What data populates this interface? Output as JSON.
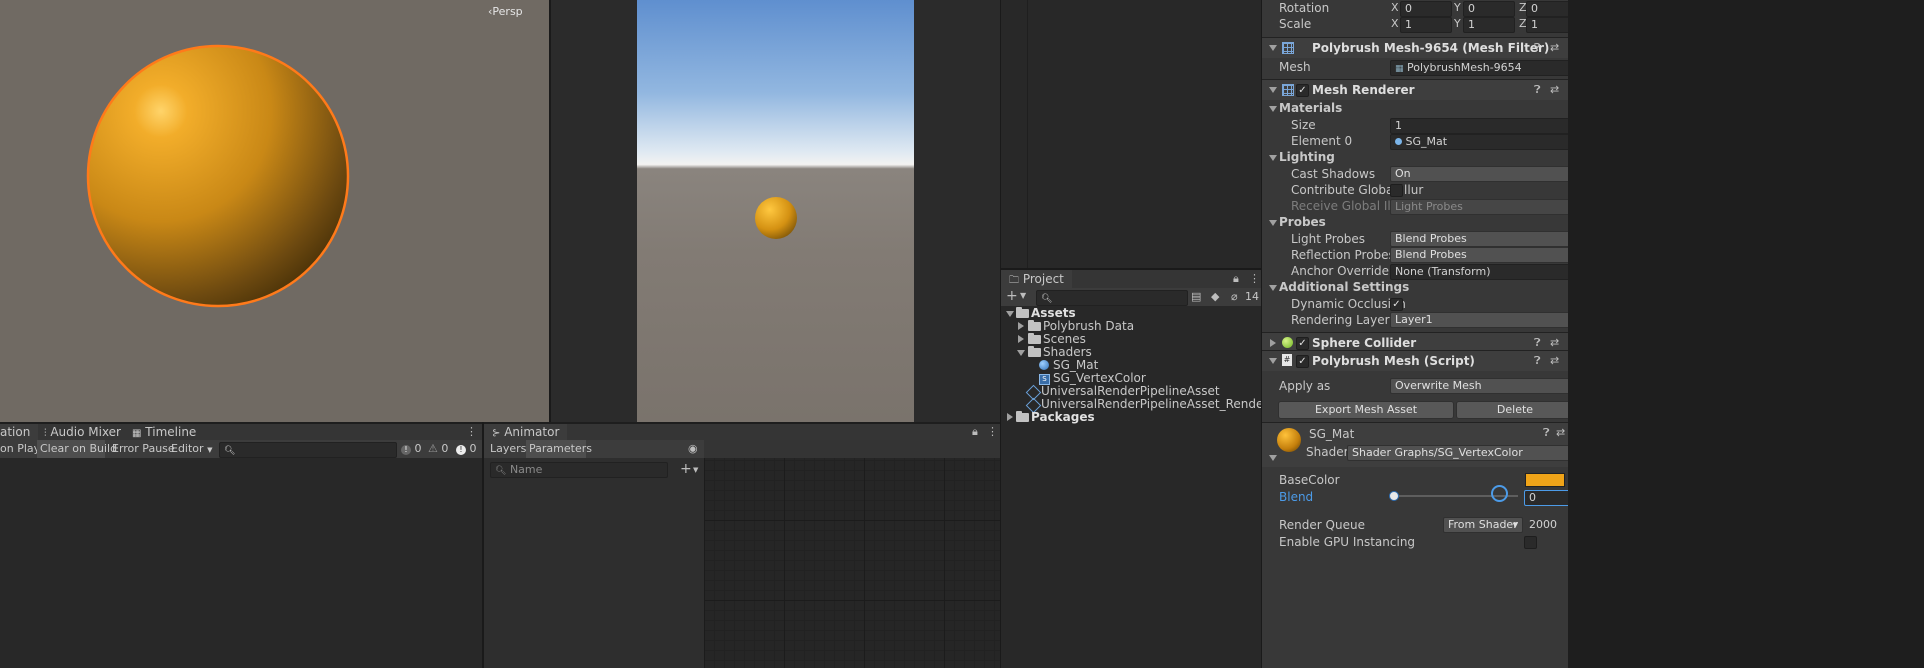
{
  "scene_view": {
    "persp_label": "Persp"
  },
  "console": {
    "tabs": [
      "ation",
      "Audio Mixer",
      "Timeline"
    ],
    "toolbar": [
      "on Play",
      "Clear on Build",
      "Error Pause",
      "Editor"
    ],
    "counts": [
      "0",
      "0",
      "0"
    ]
  },
  "animator": {
    "tab": "Animator",
    "subtabs": [
      "Layers",
      "Parameters"
    ],
    "name_placeholder": "Name"
  },
  "project": {
    "tab": "Project",
    "hidden_count": "14",
    "tree": [
      "Assets",
      "Polybrush Data",
      "Scenes",
      "Shaders",
      "SG_Mat",
      "SG_VertexColor",
      "UniversalRenderPipelineAsset",
      "UniversalRenderPipelineAsset_Renderer",
      "Packages"
    ]
  },
  "inspector": {
    "transform": {
      "rotation_label": "Rotation",
      "scale_label": "Scale",
      "rotation": {
        "x": "0",
        "y": "0",
        "z": "0"
      },
      "scale": {
        "x": "1",
        "y": "1",
        "z": "1"
      },
      "axes": [
        "X",
        "Y",
        "Z"
      ]
    },
    "mesh_filter": {
      "title": "Polybrush Mesh-9654 (Mesh Filter)",
      "mesh_label": "Mesh",
      "mesh_value": "PolybrushMesh-9654"
    },
    "mesh_renderer": {
      "title": "Mesh Renderer",
      "materials_label": "Materials",
      "size_label": "Size",
      "size_value": "1",
      "element0_label": "Element 0",
      "element0_value": "SG_Mat",
      "lighting_label": "Lighting",
      "cast_shadows_label": "Cast Shadows",
      "cast_shadows_value": "On",
      "contribute_gi_label": "Contribute Global Illur",
      "receive_gi_label": "Receive Global Illumir",
      "receive_gi_value": "Light Probes",
      "probes_label": "Probes",
      "light_probes_label": "Light Probes",
      "light_probes_value": "Blend Probes",
      "reflection_probes_label": "Reflection Probes",
      "reflection_probes_value": "Blend Probes",
      "anchor_override_label": "Anchor Override",
      "anchor_override_value": "None (Transform)",
      "additional_settings_label": "Additional Settings",
      "dynamic_occlusion_label": "Dynamic Occlusion",
      "rendering_layer_label": "Rendering Layer Mas",
      "rendering_layer_value": "Layer1"
    },
    "sphere_collider": {
      "title": "Sphere Collider"
    },
    "polybrush_script": {
      "title": "Polybrush Mesh (Script)",
      "apply_as_label": "Apply as",
      "apply_as_value": "Overwrite Mesh",
      "export_button": "Export Mesh Asset",
      "delete_button": "Delete"
    },
    "material": {
      "name": "SG_Mat",
      "shader_label": "Shader",
      "shader_value": "Shader Graphs/SG_VertexColor",
      "basecolor_label": "BaseColor",
      "basecolor_color": "#f0a418",
      "blend_label": "Blend",
      "blend_value": "0",
      "render_queue_label": "Render Queue",
      "render_queue_mode": "From Shader",
      "render_queue_value": "2000",
      "gpu_instancing_label": "Enable GPU Instancing"
    }
  },
  "colors": {
    "selection_outline": "#ff7a1a",
    "sphere": "#e8a020",
    "blend_label": "#4c9be8"
  }
}
